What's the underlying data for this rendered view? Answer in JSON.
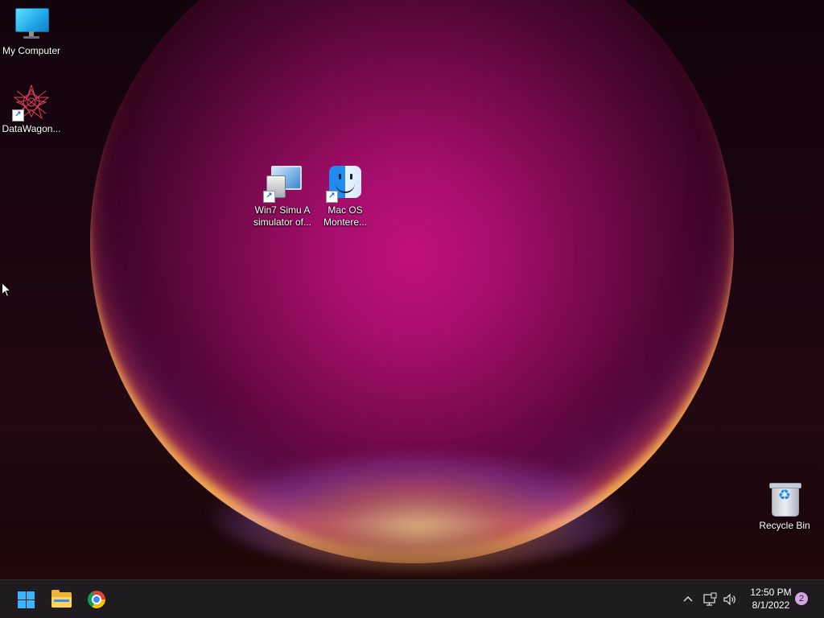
{
  "desktop": {
    "icons": [
      {
        "label": "My Computer",
        "icon": "monitor-icon",
        "shortcut": false
      },
      {
        "label": "DataWagon...",
        "icon": "datawagon-star-icon",
        "shortcut": true
      },
      {
        "label": "Win7 Simu   A\nsimulator of...",
        "icon": "win7-simulator-icon",
        "shortcut": true
      },
      {
        "label": "Mac OS\nMontere...",
        "icon": "finder-icon",
        "shortcut": true
      },
      {
        "label": "Recycle Bin",
        "icon": "recycle-bin-icon",
        "shortcut": false
      }
    ]
  },
  "taskbar": {
    "pinned": [
      {
        "name": "Start",
        "icon": "windows-start-icon"
      },
      {
        "name": "File Explorer",
        "icon": "file-explorer-icon"
      },
      {
        "name": "Google Chrome",
        "icon": "chrome-icon"
      }
    ],
    "tray": {
      "chevron_icon": "chevron-up-icon",
      "network_icon": "network-icon",
      "volume_icon": "volume-icon",
      "time": "12:50 PM",
      "date": "8/1/2022",
      "notification_count": "2"
    }
  },
  "colors": {
    "taskbar_bg": "#1f1c1f",
    "start_accent": "#3ab4ff",
    "wallpaper_magenta": "#c0107a"
  }
}
